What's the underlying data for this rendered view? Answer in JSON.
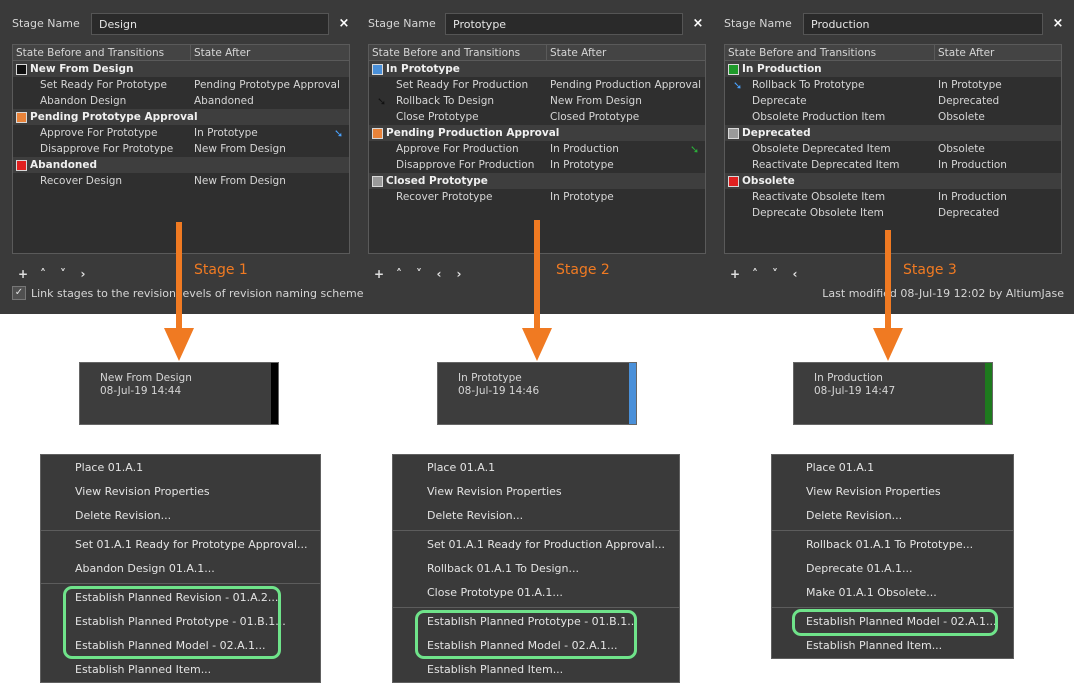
{
  "stages": [
    {
      "name_label": "Stage Name",
      "name_value": "Design",
      "close_icon": "×",
      "headers": [
        "State Before and Transitions",
        "State After"
      ],
      "caption": "Stage 1",
      "toolbar": [
        "+",
        "˄",
        "˅",
        "›"
      ],
      "states": [
        {
          "label": "New From Design",
          "color": "#111111",
          "transitions": [
            {
              "name": "Set Ready For Prototype",
              "after": "Pending Prototype Approval"
            },
            {
              "name": "Abandon Design",
              "after": "Abandoned"
            }
          ]
        },
        {
          "label": "Pending Prototype Approval",
          "color": "#e8833a",
          "transitions": [
            {
              "name": "Approve For Prototype",
              "after": "In Prototype",
              "icon_right": "blue-arrow-icon"
            },
            {
              "name": "Disapprove For Prototype",
              "after": "New From Design"
            }
          ]
        },
        {
          "label": "Abandoned",
          "color": "#e02020",
          "transitions": [
            {
              "name": "Recover Design",
              "after": "New From Design"
            }
          ]
        }
      ]
    },
    {
      "name_label": "Stage Name",
      "name_value": "Prototype",
      "close_icon": "×",
      "headers": [
        "State Before and Transitions",
        "State After"
      ],
      "caption": "Stage 2",
      "toolbar": [
        "+",
        "˄",
        "˅",
        "‹",
        "›"
      ],
      "states": [
        {
          "label": "In Prototype",
          "color": "#4a90d9",
          "transitions": [
            {
              "name": "Set Ready For Production",
              "after": "Pending Production Approval"
            },
            {
              "name": "Rollback To Design",
              "after": "New From Design",
              "icon_left": "black-arrow-icon"
            },
            {
              "name": "Close Prototype",
              "after": "Closed Prototype"
            }
          ]
        },
        {
          "label": "Pending Production Approval",
          "color": "#e8833a",
          "transitions": [
            {
              "name": "Approve For Production",
              "after": "In Production",
              "icon_right": "green-arrow-icon"
            },
            {
              "name": "Disapprove For Production",
              "after": "In Prototype"
            }
          ]
        },
        {
          "label": "Closed Prototype",
          "color": "#9a9a9a",
          "transitions": [
            {
              "name": "Recover Prototype",
              "after": "In Prototype"
            }
          ]
        }
      ]
    },
    {
      "name_label": "Stage Name",
      "name_value": "Production",
      "close_icon": "×",
      "headers": [
        "State Before and Transitions",
        "State After"
      ],
      "caption": "Stage 3",
      "toolbar": [
        "+",
        "˄",
        "˅",
        "‹"
      ],
      "states": [
        {
          "label": "In Production",
          "color": "#1e9a2a",
          "transitions": [
            {
              "name": "Rollback To Prototype",
              "after": "In Prototype",
              "icon_left": "blue-arrow-icon"
            },
            {
              "name": "Deprecate",
              "after": "Deprecated"
            },
            {
              "name": "Obsolete Production Item",
              "after": "Obsolete"
            }
          ]
        },
        {
          "label": "Deprecated",
          "color": "#9a9a9a",
          "transitions": [
            {
              "name": "Obsolete Deprecated Item",
              "after": "Obsolete"
            },
            {
              "name": "Reactivate Deprecated Item",
              "after": "In Production"
            }
          ]
        },
        {
          "label": "Obsolete",
          "color": "#e02020",
          "transitions": [
            {
              "name": "Reactivate Obsolete Item",
              "after": "In Production"
            },
            {
              "name": "Deprecate Obsolete Item",
              "after": "Deprecated"
            }
          ]
        }
      ]
    }
  ],
  "link_checkbox": {
    "label": "Link stages to the revision levels of revision naming scheme",
    "checked": true,
    "mark": "✓"
  },
  "last_modified": "Last modified 08-Jul-19 12:02 by AltiumJase",
  "accent_color": "#f07a22",
  "highlight_color": "#6fe38a",
  "revisions": [
    {
      "state": "New From Design",
      "date": "08-Jul-19 14:44",
      "color": "#000000"
    },
    {
      "state": "In Prototype",
      "date": "08-Jul-19 14:46",
      "color": "#4a90d9"
    },
    {
      "state": "In Production",
      "date": "08-Jul-19 14:47",
      "color": "#1e7a1e"
    }
  ],
  "menus": [
    {
      "groups": [
        [
          "Place 01.A.1",
          "View Revision Properties",
          "Delete Revision..."
        ],
        [
          "Set 01.A.1 Ready for Prototype Approval...",
          "Abandon Design 01.A.1..."
        ],
        [
          "Establish Planned Revision - 01.A.2...",
          "Establish Planned Prototype - 01.B.1...",
          "Establish Planned Model - 02.A.1...",
          "Establish Planned Item..."
        ]
      ]
    },
    {
      "groups": [
        [
          "Place 01.A.1",
          "View Revision Properties",
          "Delete Revision..."
        ],
        [
          "Set 01.A.1 Ready for Production Approval...",
          "Rollback 01.A.1 To Design...",
          "Close Prototype 01.A.1..."
        ],
        [
          "Establish Planned Prototype - 01.B.1...",
          "Establish Planned Model - 02.A.1...",
          "Establish Planned Item..."
        ]
      ]
    },
    {
      "groups": [
        [
          "Place 01.A.1",
          "View Revision Properties",
          "Delete Revision..."
        ],
        [
          "Rollback 01.A.1 To Prototype...",
          "Deprecate 01.A.1...",
          "Make 01.A.1 Obsolete..."
        ],
        [
          "Establish Planned Model - 02.A.1...",
          "Establish Planned Item..."
        ]
      ]
    }
  ]
}
